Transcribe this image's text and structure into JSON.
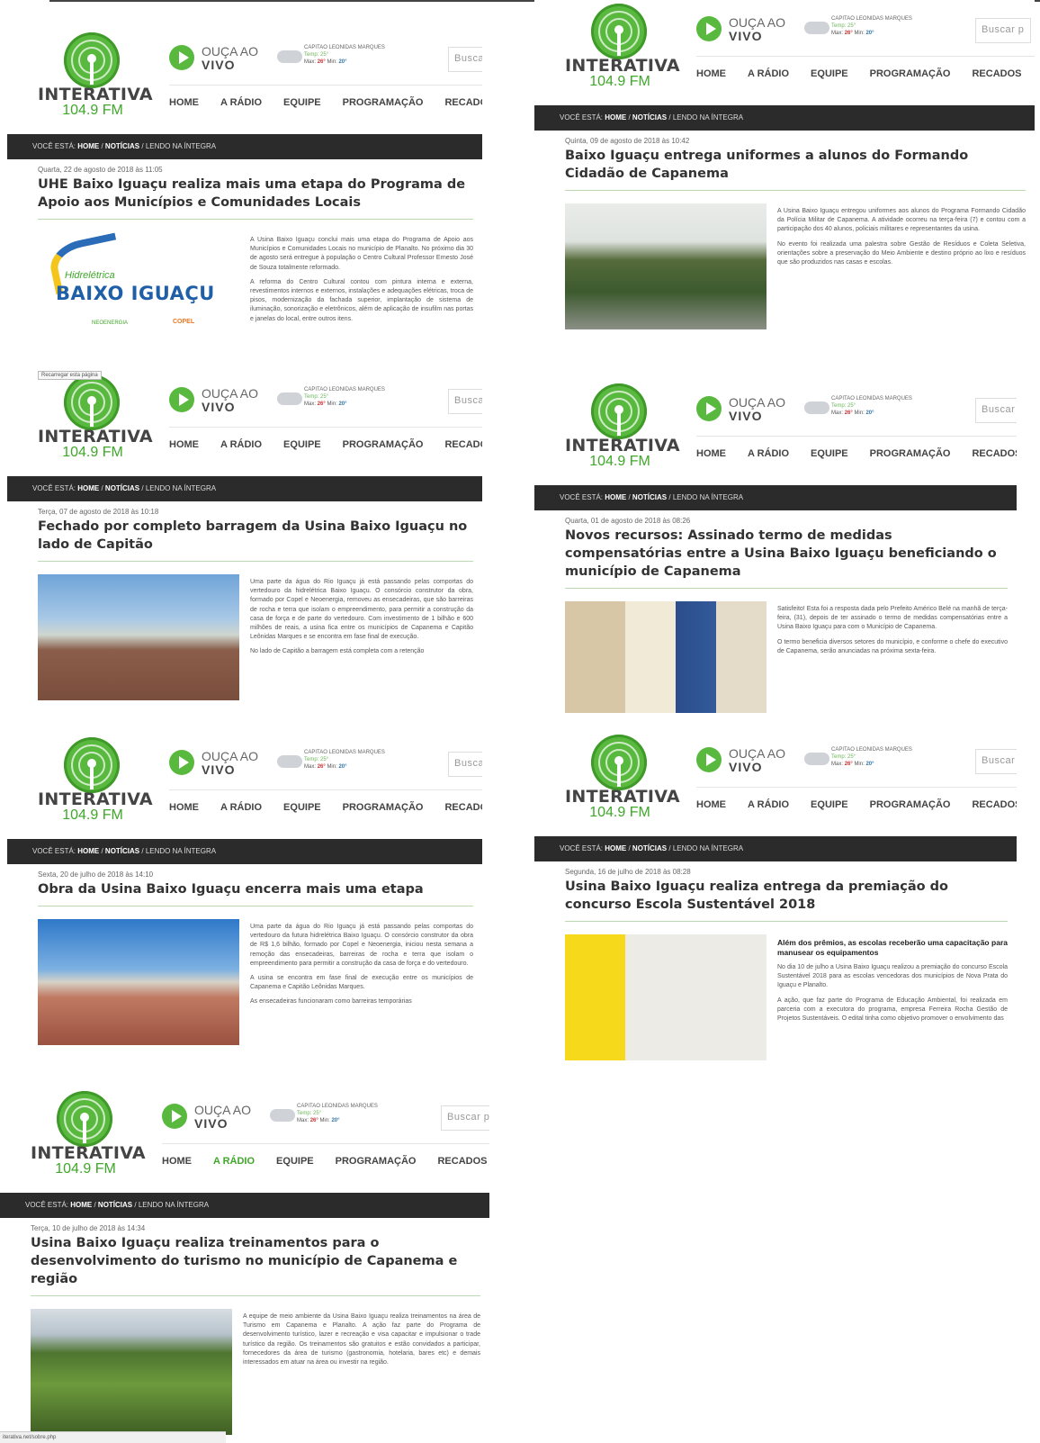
{
  "colors": {
    "accent": "#58b93e",
    "dark_bar": "#2b2b2b",
    "title": "#333333"
  },
  "brand": {
    "name": "INTERATIVA",
    "frequency": "104.9 FM",
    "live_line1": "OUÇA AO",
    "live_line2": "VIVO"
  },
  "weather": {
    "city": "CAPITAO LEONIDAS MARQUES",
    "temp": "Temp: 25°",
    "max_label": "Max:",
    "max": "26°",
    "min_label": "Min:",
    "min": "20°"
  },
  "search": {
    "placeholder": "Buscar p"
  },
  "nav": {
    "items": [
      "HOME",
      "A RÁDIO",
      "EQUIPE",
      "PROGRAMAÇÃO",
      "RECADOS"
    ]
  },
  "breadcrumb": {
    "prefix": "VOCÊ ESTÁ:",
    "home": "HOME",
    "news": "NOTÍCIAS",
    "current": "LENDO NA ÍNTEGRA"
  },
  "tooltip": "Recarregar esta página",
  "status_url": "iterativa.net/sobre.php",
  "articles": [
    {
      "date": "Quarta, 22 de agosto de 2018 às 11:05",
      "title": "UHE Baixo Iguaçu realiza mais uma etapa do Programa de Apoio aos Municípios e Comunidades Locais",
      "image": "Hidrelétrica Baixo Iguaçu logo",
      "logo_small": "Hidrelétrica",
      "logo_big": "BAIXO IGUAÇU",
      "logo_p1": "NEOENERGIA",
      "logo_p2": "COPEL",
      "paragraphs": [
        "A Usina Baixo Iguaçu conclui mais uma etapa do Programa de Apoio aos Municípios e Comunidades Locais no município de Planalto. No próximo dia 30 de agosto será entregue à população o Centro Cultural Professor Ernesto José de Souza totalmente reformado.",
        "A reforma do Centro Cultural contou com pintura interna e externa, revestimentos internos e externos, instalações e adequações elétricas, troca de pisos, modernização da fachada superior, implantação de sistema de iluminação, sonorização e eletrônicos, além de aplicação de insufilm nas portas e janelas do local, entre outros itens."
      ]
    },
    {
      "date": "Quinta, 09 de agosto de 2018 às 10:42",
      "title": "Baixo Iguaçu entrega uniformes a alunos do Formando Cidadão de Capanema",
      "image": "group photo students",
      "paragraphs": [
        "A Usina Baixo Iguaçu entregou uniformes aos alunos do Programa Formando Cidadão da Polícia Militar de Capanema. A atividade ocorreu na terça-feira (7) e contou com a participação dos 40 alunos, policiais militares e representantes da usina.",
        "No evento foi realizada uma palestra sobre Gestão de Resíduos e Coleta Seletiva, orientações sobre a preservação do Meio Ambiente e destino próprio ao lixo e resíduos que são produzidos nas casas e escolas."
      ]
    },
    {
      "date": "Terça, 07 de agosto de 2018 às 10:18",
      "title": "Fechado por completo barragem da Usina Baixo Iguaçu no lado de Capitão",
      "image": "dam river photo",
      "paragraphs": [
        "Uma parte da água do Rio Iguaçu já está passando pelas comportas do vertedouro da hidrelétrica Baixo Iguaçu. O consórcio construtor da obra, formado por Copel e Neoenergia, removeu as ensecadeiras, que são barreiras de rocha e terra que isolam o empreendimento, para permitir a construção da casa de força e de parte do vertedouro. Com investimento de 1 bilhão e 600 milhões de reais, a usina fica entre os municípios de Capanema e Capitão Leônidas Marques e se encontra em fase final de execução.",
        "No lado de Capitão a barragem está completa com a retenção"
      ]
    },
    {
      "date": "Quarta, 01 de agosto de 2018 às 08:26",
      "title": "Novos recursos: Assinado termo de medidas compensatórias entre a Usina Baixo Iguaçu beneficiando o município de Capanema",
      "image": "office signing photo",
      "paragraphs": [
        "Satisfeito! Esta foi a resposta dada pelo Prefeito Américo Belé na manhã de terça-feira, (31), depois de ter assinado o termo de medidas compensatórias entre a Usina Baixo Iguaçu para com o Município de Capanema.",
        "O termo beneficia diversos setores do município, e conforme o chefe do executivo de Capanema, serão anunciadas na próxima sexta-feira."
      ]
    },
    {
      "date": "Sexta, 20 de julho de 2018 às 14:10",
      "title": "Obra da Usina Baixo Iguaçu encerra mais uma etapa",
      "image": "spillway photo",
      "paragraphs": [
        "Uma parte da água do Rio Iguaçu já está passando pelas comportas do vertedouro da futura hidrelétrica Baixo Iguaçu. O consórcio construtor da obra de R$ 1,6 bilhão, formado por Copel e Neoenergia, iniciou nesta semana a remoção das ensecadeiras, barreiras de rocha e terra que isolam o empreendimento para permitir a construção da casa de força e do vertedouro.",
        "A usina se encontra em fase final de execução entre os municípios de Capanema e Capitão Leônidas Marques.",
        "As ensecadeiras funcionaram como barreiras temporárias"
      ]
    },
    {
      "date": "Segunda, 16 de julho de 2018 às 08:28",
      "title": "Usina Baixo Iguaçu realiza entrega da premiação do concurso Escola Sustentável 2018",
      "image": "school award photo",
      "lead": "Além dos prêmios, as escolas receberão uma capacitação para manusear os equipamentos",
      "paragraphs": [
        "No dia 10 de julho a Usina Baixo Iguaçu realizou a premiação do concurso Escola Sustentável 2018 para as escolas vencedoras dos municípios de Nova Prata do Iguaçu e Planalto.",
        "A ação, que faz parte do Programa de Educação Ambiental, foi realizada em parceria com a executora do programa, empresa Ferreira Rocha Gestão de Projetos Sustentáveis. O edital tinha como objetivo promover o envolvimento das"
      ]
    },
    {
      "date": "Terça, 10 de julho de 2018 às 14:34",
      "title": "Usina Baixo Iguaçu realiza treinamentos para o desenvolvimento do turismo no município de Capanema e região",
      "image": "aerial forest photo",
      "paragraphs": [
        "A equipe de meio ambiente da Usina Baixo Iguaçu realiza treinamentos na área de Turismo em Capanema e Planalto. A ação faz parte do Programa de desenvolvimento turístico, lazer e recreação e visa capacitar e impulsionar o trade turístico da região. Os treinamentos são gratuitos e estão convidados a participar, fornecedores da área de turismo (gastronomia, hotelaria, bares etc) e demais interessados em atuar na área ou investir na região."
      ]
    }
  ]
}
